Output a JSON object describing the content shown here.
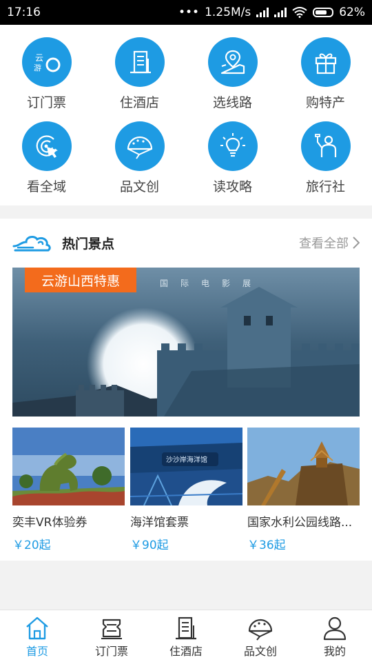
{
  "status_bar": {
    "time": "17:16",
    "speed": "1.25M/s",
    "battery": "62%"
  },
  "grid": [
    {
      "label": "订门票",
      "icon": "ticket-icon"
    },
    {
      "label": "住酒店",
      "icon": "hotel-icon"
    },
    {
      "label": "选线路",
      "icon": "route-map-icon"
    },
    {
      "label": "购特产",
      "icon": "gift-icon"
    },
    {
      "label": "看全域",
      "icon": "target-icon"
    },
    {
      "label": "品文创",
      "icon": "fan-icon"
    },
    {
      "label": "读攻略",
      "icon": "lightbulb-icon"
    },
    {
      "label": "旅行社",
      "icon": "travel-agency-icon"
    }
  ],
  "hot": {
    "title": "热门景点",
    "see_all": "查看全部",
    "banner": {
      "tag": "云游山西特惠",
      "caption": "国际电影展"
    },
    "cards": [
      {
        "title": "奕丰VR体验券",
        "price": "￥20起"
      },
      {
        "title": "海洋馆套票",
        "price": "￥90起"
      },
      {
        "title": "国家水利公园线路...",
        "price": "￥36起"
      }
    ]
  },
  "tabbar": [
    {
      "label": "首页",
      "icon": "home-icon",
      "active": true
    },
    {
      "label": "订门票",
      "icon": "ticket-icon",
      "active": false
    },
    {
      "label": "住酒店",
      "icon": "hotel-icon",
      "active": false
    },
    {
      "label": "品文创",
      "icon": "fan-icon",
      "active": false
    },
    {
      "label": "我的",
      "icon": "user-icon",
      "active": false
    }
  ],
  "colors": {
    "accent": "#1e9be3",
    "tag": "#f36b1c",
    "background": "#f2f2f2"
  }
}
